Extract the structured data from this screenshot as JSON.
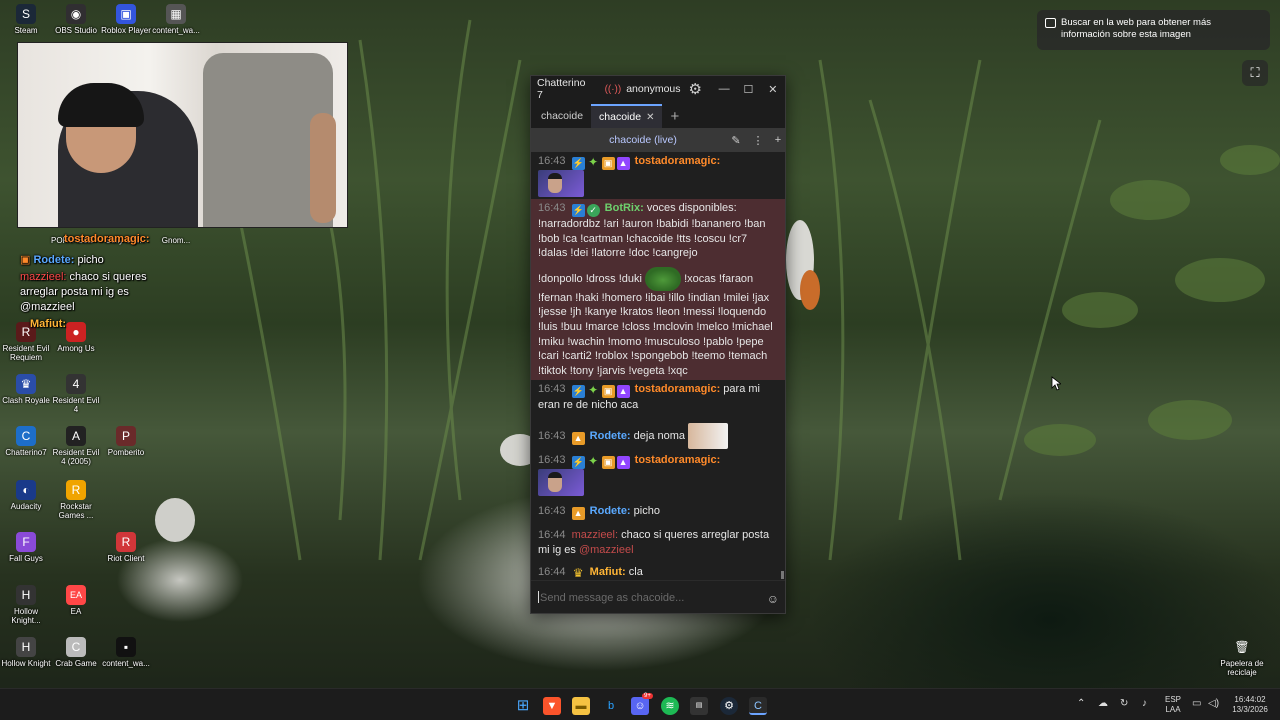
{
  "desktop": {
    "icons": [
      {
        "label": "Steam",
        "glyph": "S",
        "color": "#1b2838"
      },
      {
        "label": "OBS Studio",
        "glyph": "◉",
        "color": "#302e31"
      },
      {
        "label": "Roblox Player",
        "glyph": "▣",
        "color": "#3355dd"
      },
      {
        "label": "content_wa...",
        "glyph": "▦",
        "color": "#555"
      },
      {
        "label": "PORTABLE",
        "glyph": "◆",
        "color": "#666"
      },
      {
        "label": "Bully Onli...",
        "glyph": "B",
        "color": "#7a4a20"
      },
      {
        "label": "Gnom...",
        "glyph": "G",
        "color": "#446"
      },
      {
        "label": "Resident Evil Requiem",
        "glyph": "R",
        "color": "#5a1a1a"
      },
      {
        "label": "Among Us",
        "glyph": "●",
        "color": "#c22"
      },
      {
        "label": "Clash Royale",
        "glyph": "♛",
        "color": "#2a4da8"
      },
      {
        "label": "Resident Evil 4",
        "glyph": "4",
        "color": "#333"
      },
      {
        "label": "Chatterino7",
        "glyph": "C",
        "color": "#1d6ec9"
      },
      {
        "label": "Resident Evil 4 (2005)",
        "glyph": "A",
        "color": "#222"
      },
      {
        "label": "Pomberito",
        "glyph": "P",
        "color": "#6a2a2a"
      },
      {
        "label": "Audacity",
        "glyph": "◐",
        "color": "#1a3a8a"
      },
      {
        "label": "Rockstar Games ...",
        "glyph": "R",
        "color": "#f0a400"
      },
      {
        "label": "Fall Guys",
        "glyph": "F",
        "color": "#8a4ad8"
      },
      {
        "label": "Riot Client",
        "glyph": "R",
        "color": "#d13639"
      },
      {
        "label": "Hollow Knight...",
        "glyph": "H",
        "color": "#333"
      },
      {
        "label": "EA",
        "glyph": "EA",
        "color": "#ff4747"
      },
      {
        "label": "Hollow Knight",
        "glyph": "H",
        "color": "#444"
      },
      {
        "label": "Crab Game",
        "glyph": "C",
        "color": "#bbb"
      },
      {
        "label": "content_wa...",
        "glyph": "▪",
        "color": "#111"
      },
      {
        "label": "Papelera de reciclaje",
        "glyph": "🗑",
        "color": "#556"
      }
    ],
    "overlay_chat": [
      {
        "user": "tostadoramagic:",
        "text": "",
        "color": "#ff8a2a"
      },
      {
        "user": "Rodete:",
        "text": "picho",
        "color": "#5aa9ff"
      },
      {
        "user": "mazzieel:",
        "text": "chaco si queres arreglar posta mi ig es @mazzieel",
        "color": "#ff4a4a"
      },
      {
        "user": "Mafiut:",
        "text": "cla",
        "color": "#ffb536"
      }
    ],
    "lens_popup": "Buscar en la web para obtener más información sobre esta imagen"
  },
  "chatterino": {
    "title": "Chatterino 7",
    "user": "anonymous",
    "tabs": [
      {
        "label": "chacoide"
      },
      {
        "label": "chacoide"
      }
    ],
    "channel_title": "chacoide (live)",
    "input_placeholder": "Send message as chacoide...",
    "messages": [
      {
        "time": "16:43",
        "user": "tostadoramagic:",
        "text": ""
      },
      {
        "time": "16:43",
        "user": "BotRix:",
        "text": "voces disponibles: !narradordbz !ari !auron !babidi !bananero !ban !bob !ca !cartman !chacoide !tts !coscu !cr7 !dalas !dei !latorre !doc !cangrejo"
      },
      {
        "time": "",
        "user": "",
        "text_a": "!donpollo !dross !duki",
        "text_b": "!xocas !faraon !fernan !haki !homero !ibai !illo !indian !milei !jax !jesse !jh !kanye !kratos !leon !messi !loquendo !luis !buu !marce !closs !mclovin !melco !michael !miku !wachin !momo !musculoso !pablo !pepe !cari !carti2 !roblox !spongebob !teemo !temach !tiktok !tony !jarvis !vegeta !xqc"
      },
      {
        "time": "16:43",
        "user": "tostadoramagic:",
        "text": "para mi eran re de nicho aca"
      },
      {
        "time": "16:43",
        "user": "Rodete:",
        "text": "deja noma"
      },
      {
        "time": "16:43",
        "user": "tostadoramagic:",
        "text": ""
      },
      {
        "time": "16:43",
        "user": "Rodete:",
        "text": "picho"
      },
      {
        "time": "16:44",
        "user": "mazzieel:",
        "text": "chaco si queres arreglar posta mi ig es",
        "mention": "@mazzieel"
      },
      {
        "time": "16:44",
        "user": "Mafiut:",
        "text": "cla"
      }
    ]
  },
  "taskbar": {
    "lang": "ESP",
    "lang2": "LAA",
    "time": "16:44:02",
    "date": "13/3/2026",
    "discord_badge": "9+"
  }
}
